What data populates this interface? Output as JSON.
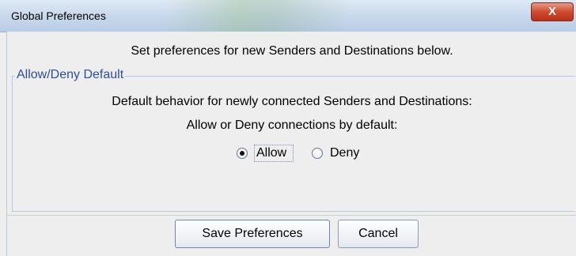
{
  "window": {
    "title": "Global Preferences",
    "close_label": "X"
  },
  "main": {
    "heading": "Set preferences for new Senders and Destinations below."
  },
  "group": {
    "label": "Allow/Deny Default",
    "description": "Default behavior for newly connected Senders and Destinations:",
    "prompt": "Allow or Deny connections by default:",
    "options": [
      {
        "label": "Allow",
        "selected": true
      },
      {
        "label": "Deny",
        "selected": false
      }
    ]
  },
  "buttons": {
    "save_label": "Save Preferences",
    "cancel_label": "Cancel"
  },
  "colors": {
    "group_label": "#2b4fa0",
    "close_button": "#d04a30"
  }
}
